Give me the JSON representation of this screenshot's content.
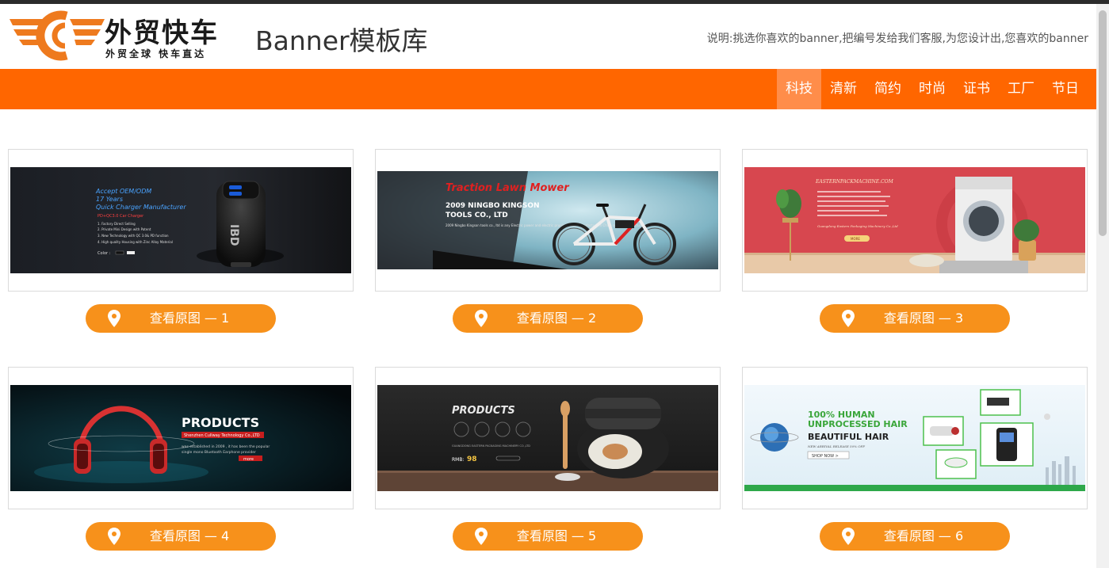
{
  "header": {
    "logo_text": "外贸快车",
    "logo_slogan": "外贸全球 快车直达",
    "site_title": "Banner模板库",
    "note": "说明:挑选你喜欢的banner,把编号发给我们客服,为您设计出,您喜欢的banner"
  },
  "nav": {
    "items": [
      {
        "label": "科技",
        "active": true
      },
      {
        "label": "清新"
      },
      {
        "label": "简约"
      },
      {
        "label": "时尚"
      },
      {
        "label": "证书"
      },
      {
        "label": "工厂"
      },
      {
        "label": "节日"
      }
    ]
  },
  "cards": [
    {
      "button_label": "查看原图 — 1",
      "banner": {
        "heading": "Accept OEM/ODM",
        "subheading": "17 Years",
        "tagline": "Quick Charger Manufacturer",
        "model": "PD+QC3.0 Car Charger",
        "features": [
          "1. Factory Direct Selling",
          "2. Private Mini Design with Patent",
          "3. New Technology with QC 3.0& PD function",
          "4. High quality Housing with Zinc Alloy Material"
        ],
        "color_label": "Color :",
        "brand_mark": "IBD"
      }
    },
    {
      "button_label": "查看原图 — 2",
      "banner": {
        "heading": "Traction Lawn Mower",
        "company_line1": "2009 NINGBO KINGSON",
        "company_line2": "TOOLS CO., LTD",
        "body": "2009 Ningbo Kingson tools co., ltd is any Electric power and electric pruning shear manufacture in China ale to Manufacture"
      }
    },
    {
      "button_label": "查看原图 — 3",
      "banner": {
        "heading": "EASTERNPACKMACHINE.COM",
        "company": "Guangdong Eastern Packaging Machinery Co.,Ltd",
        "button": "MORE"
      }
    },
    {
      "button_label": "查看原图 — 4",
      "banner": {
        "heading": "PRODUCTS",
        "company": "Shenzhen Cullway Technology Co.,LTD",
        "body1": "was established in 2009 , it has been the popular",
        "body2": "single mono Bluetooth Earphone provider",
        "button": "more"
      }
    },
    {
      "button_label": "查看原图 — 5",
      "banner": {
        "heading": "PRODUCTS",
        "company": "GUANGDONG EASTERN PACKAGING MACHINERY CO.,LTD",
        "price_label": "RMB:",
        "price": "98"
      }
    },
    {
      "button_label": "查看原图 — 6",
      "banner": {
        "heading1": "100% HUMAN",
        "heading2": "UNPROCESSED HAIR",
        "heading3": "BEAUTIFUL HAIR",
        "sale": "NEW ARRIVAL RELEASE 50% OFF",
        "button": "SHOP NOW >"
      }
    }
  ],
  "colors": {
    "brand_orange": "#ff6600",
    "nav_active": "#ff8d4a",
    "button": "#f7911b",
    "topbar": "#2b2b2b"
  },
  "icons": {
    "button_icon": "location-pin-icon"
  }
}
